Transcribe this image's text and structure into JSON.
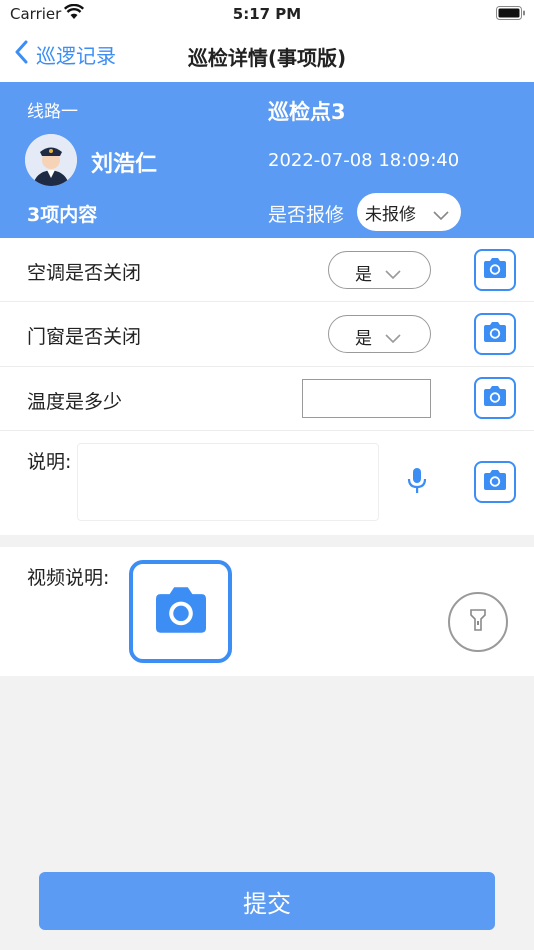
{
  "status_bar": {
    "carrier": "Carrier",
    "time": "5:17 PM"
  },
  "nav": {
    "back_label": "巡逻记录",
    "title": "巡检详情(事项版)"
  },
  "header": {
    "route": "线路一",
    "point": "巡检点3",
    "person": "刘浩仁",
    "datetime": "2022-07-08 18:09:40",
    "item_count": "3项内容",
    "repair_label": "是否报修",
    "repair_value": "未报修"
  },
  "items": [
    {
      "label": "空调是否关闭",
      "value": "是"
    },
    {
      "label": "门窗是否关闭",
      "value": "是"
    },
    {
      "label": "温度是多少",
      "value": ""
    }
  ],
  "description": {
    "label": "说明:",
    "value": ""
  },
  "video": {
    "label": "视频说明:"
  },
  "submit_label": "提交",
  "colors": {
    "accent": "#3c8ef5",
    "header_bg": "#5b9bf3",
    "page_bg": "#f2f2f2"
  }
}
